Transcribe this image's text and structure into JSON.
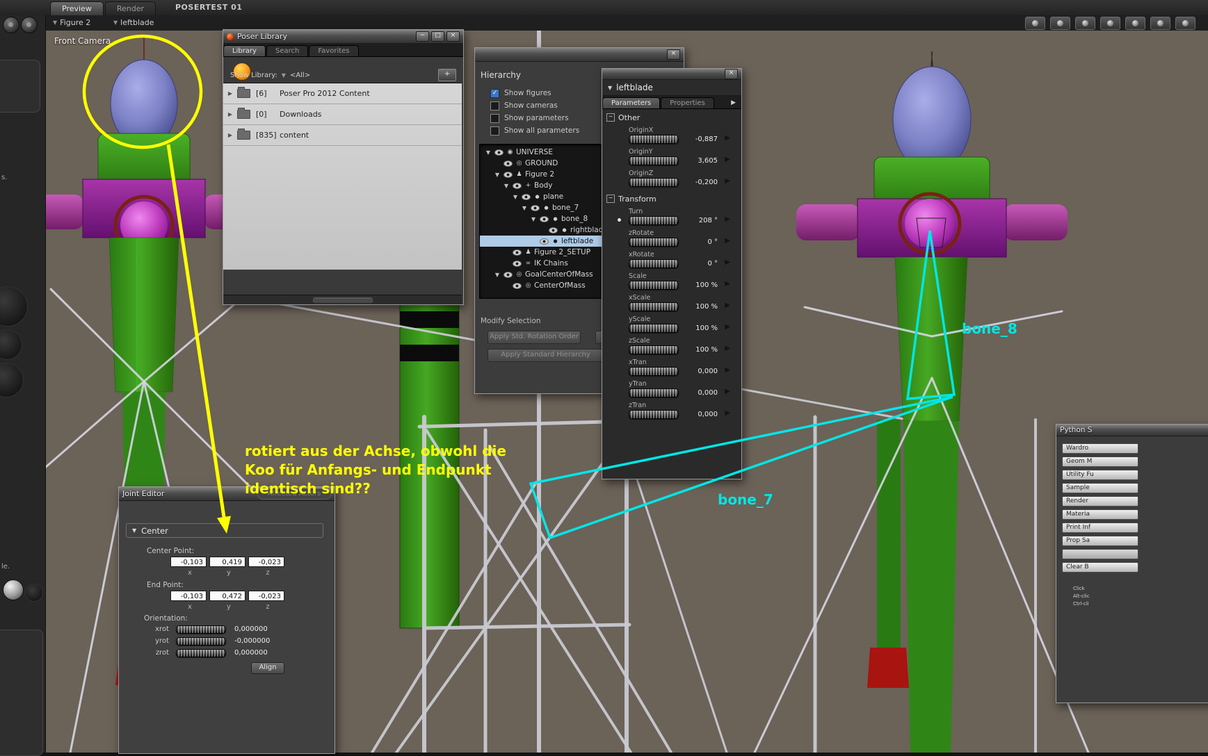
{
  "topbar": {
    "tabs": [
      {
        "label": "Preview",
        "active": true
      },
      {
        "label": "Render",
        "active": false
      }
    ],
    "title": "POSERTEST 01"
  },
  "actor_bar": {
    "figure": "Figure 2",
    "actor": "leftblade"
  },
  "viewport": {
    "camera_label": "Front Camera"
  },
  "window_controls": {
    "minimize": "−",
    "maximize": "□",
    "close": "×"
  },
  "icons": {
    "dropdown": "▼",
    "expand": "▶",
    "collapse": "▼",
    "arrow_right": "▶",
    "minus": "−",
    "check": "✓",
    "plus": "+",
    "ik": "∞"
  },
  "sidebar": {
    "fragments": [
      "s.",
      "le."
    ]
  },
  "library": {
    "title": "Poser Library",
    "tabs": [
      {
        "label": "Library",
        "active": true
      },
      {
        "label": "Search",
        "active": false
      },
      {
        "label": "Favorites",
        "active": false
      }
    ],
    "show_library_label": "Show Library:",
    "show_library_value": "<All>",
    "items": [
      {
        "count": "[6]",
        "label": "Poser Pro 2012 Content"
      },
      {
        "count": "[0]",
        "label": "Downloads"
      },
      {
        "count": "[835]",
        "label": "content"
      }
    ]
  },
  "hierarchy": {
    "title": "Hierarchy",
    "options": [
      {
        "label": "Show figures",
        "checked": true
      },
      {
        "label": "Show cameras",
        "checked": false
      },
      {
        "label": "Show parameters",
        "checked": false
      },
      {
        "label": "Show all parameters",
        "checked": false
      }
    ],
    "tree": [
      {
        "label": "UNIVERSE",
        "depth": 0,
        "expander": true,
        "icon": "universe"
      },
      {
        "label": "GROUND",
        "depth": 1,
        "expander": false,
        "icon": "ground"
      },
      {
        "label": "Figure 2",
        "depth": 1,
        "expander": true,
        "icon": "figure"
      },
      {
        "label": "Body",
        "depth": 2,
        "expander": true,
        "icon": "body"
      },
      {
        "label": "plane",
        "depth": 3,
        "expander": true,
        "icon": "prop"
      },
      {
        "label": "bone_7",
        "depth": 4,
        "expander": true,
        "icon": "prop"
      },
      {
        "label": "bone_8",
        "depth": 5,
        "expander": true,
        "icon": "prop"
      },
      {
        "label": "rightblade",
        "depth": 6,
        "expander": false,
        "icon": "prop"
      },
      {
        "label": "leftblade",
        "depth": 5,
        "expander": false,
        "icon": "prop",
        "selected": true
      },
      {
        "label": "Figure 2_SETUP",
        "depth": 2,
        "expander": false,
        "icon": "figure"
      },
      {
        "label": "IK Chains",
        "depth": 2,
        "expander": false,
        "icon": "ik"
      },
      {
        "label": "GoalCenterOfMass",
        "depth": 1,
        "expander": true,
        "icon": "goal"
      },
      {
        "label": "CenterOfMass",
        "depth": 2,
        "expander": false,
        "icon": "goal"
      }
    ],
    "modify_selection_label": "Modify Selection",
    "buttons": [
      "Apply Std. Rotation Order",
      "Apply Standard Hierarchy"
    ]
  },
  "params": {
    "header": "leftblade",
    "tabs": [
      {
        "label": "Parameters",
        "active": true
      },
      {
        "label": "Properties",
        "active": false
      }
    ],
    "sections": [
      {
        "name": "Other",
        "rows": [
          {
            "label": "OriginX",
            "value": "-0,887"
          },
          {
            "label": "OriginY",
            "value": "3,605"
          },
          {
            "label": "OriginZ",
            "value": "-0,200"
          }
        ]
      },
      {
        "name": "Transform",
        "rows": [
          {
            "label": "Turn",
            "value": "208 °",
            "key_dot": true
          },
          {
            "label": "zRotate",
            "value": "0 °"
          },
          {
            "label": "xRotate",
            "value": "0 °"
          },
          {
            "label": "Scale",
            "value": "100 %"
          },
          {
            "label": "xScale",
            "value": "100 %"
          },
          {
            "label": "yScale",
            "value": "100 %"
          },
          {
            "label": "zScale",
            "value": "100 %"
          },
          {
            "label": "xTran",
            "value": "0,000"
          },
          {
            "label": "yTran",
            "value": "0,000"
          },
          {
            "label": "zTran",
            "value": "0,000"
          }
        ]
      }
    ]
  },
  "joint_editor": {
    "title": "Joint Editor",
    "affected_actors_label": "Affected Actors",
    "section_label": "Center",
    "center_point": {
      "label": "Center Point:",
      "values": [
        "-0,103",
        "0,419",
        "-0,023"
      ]
    },
    "end_point": {
      "label": "End Point:",
      "values": [
        "-0,103",
        "0,472",
        "-0,023"
      ]
    },
    "axes": [
      "x",
      "y",
      "z"
    ],
    "orientation_label": "Orientation:",
    "orientation": [
      {
        "label": "xrot",
        "value": "0,000000"
      },
      {
        "label": "yrot",
        "value": "-0,000000"
      },
      {
        "label": "zrot",
        "value": "0,000000"
      }
    ],
    "align_label": "Align"
  },
  "python_panel": {
    "title": "Python S",
    "buttons": [
      "Wardro",
      "Geom M",
      "Utility Fu",
      "Sample",
      "Render",
      "Materia",
      "Print Inf",
      "Prop Sa",
      "",
      "Clear B"
    ],
    "hints": [
      "Click",
      "Alt-clic",
      "Ctrl-cli"
    ]
  },
  "annotations": {
    "note_lines": [
      "rotiert aus der Achse, obwohl die",
      "Koo für Anfangs- und Endpunkt",
      "identisch sind??"
    ],
    "bone7_label": "bone_7",
    "bone8_label": "bone_8",
    "yellow": "#ffff00",
    "cyan": "#00e6e6"
  },
  "colors": {
    "viewport_bg": "#6b6258",
    "figure_green": "#3a9c1c",
    "figure_purple": "#8c2090",
    "figure_magenta": "#c83ec8",
    "figure_blue": "#7d81c6",
    "figure_red": "#a81410"
  }
}
